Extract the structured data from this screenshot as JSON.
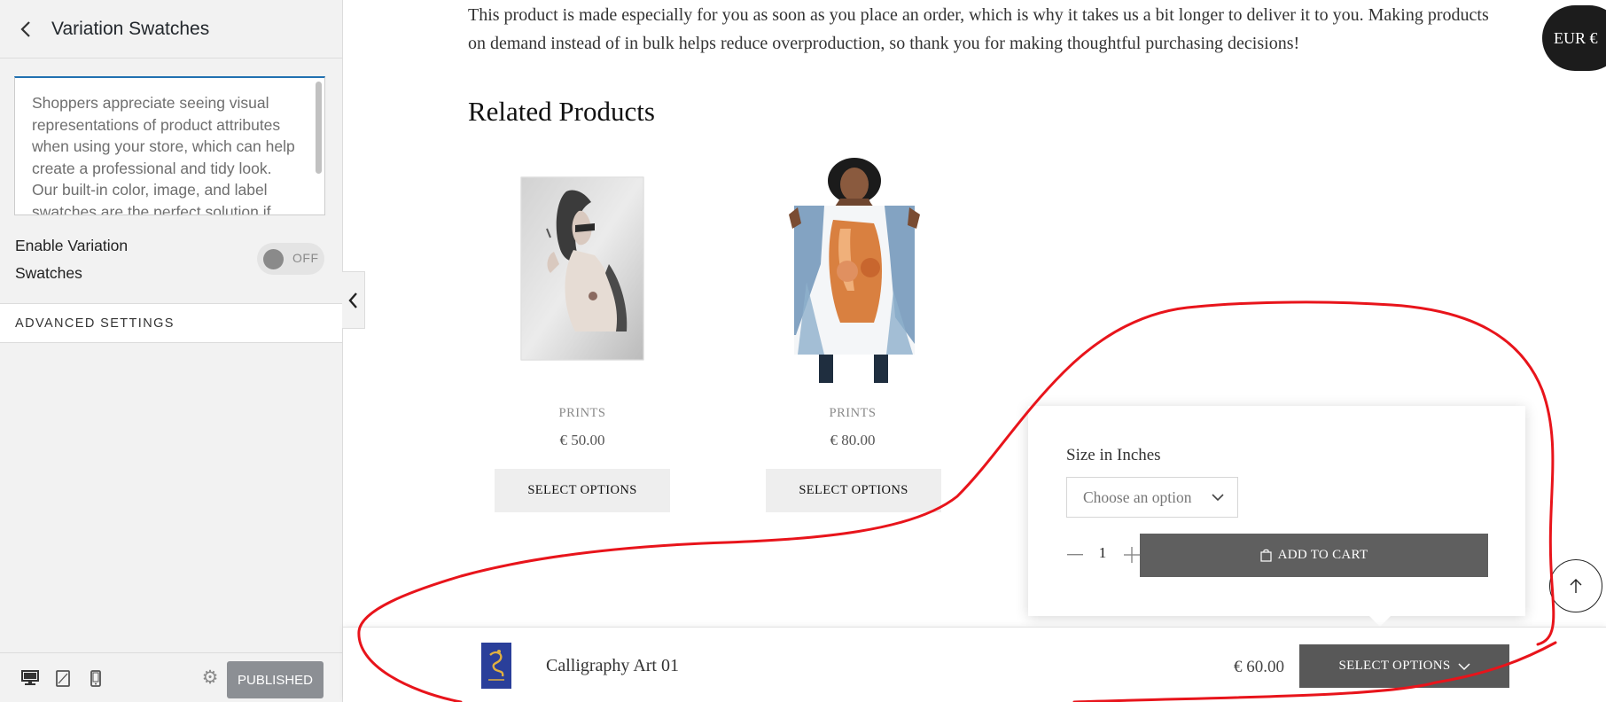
{
  "sidebar": {
    "title": "Variation Swatches",
    "description": "Shoppers appreciate seeing visual representations of product attributes when using your store, which can help create a professional and tidy look. Our built-in color, image, and label swatches are the perfect solution if",
    "toggle_label": "Enable Variation Swatches",
    "toggle_state": "OFF",
    "advanced_settings": "ADVANCED SETTINGS",
    "publish_label": "PUBLISHED",
    "devices": [
      "desktop-icon",
      "tablet-icon",
      "mobile-icon"
    ]
  },
  "page": {
    "description": "This product is made especially for you as soon as you place an order, which is why it takes us a bit longer to deliver it to you. Making products on demand instead of in bulk helps reduce overproduction, so thank you for making thoughtful purchasing decisions!",
    "related_title": "Related Products",
    "currency": "EUR €"
  },
  "related_products": [
    {
      "category": "PRINTS",
      "price": "€ 50.00",
      "button": "SELECT OPTIONS"
    },
    {
      "category": "PRINTS",
      "price": "€ 80.00",
      "button": "SELECT OPTIONS"
    }
  ],
  "variation_popup": {
    "size_label": "Size in Inches",
    "select_placeholder": "Choose an option",
    "quantity": "1",
    "add_to_cart": "ADD TO CART"
  },
  "sticky_bar": {
    "product_name": "Calligraphy Art 01",
    "price": "€ 60.00",
    "button": "SELECT OPTIONS"
  },
  "colors": {
    "annotation": "#e8141b",
    "add_to_cart_bg": "#5f5f5f",
    "sticky_button_bg": "#585858",
    "publish_bg": "#8c8f94",
    "focus_blue": "#2271b1"
  }
}
